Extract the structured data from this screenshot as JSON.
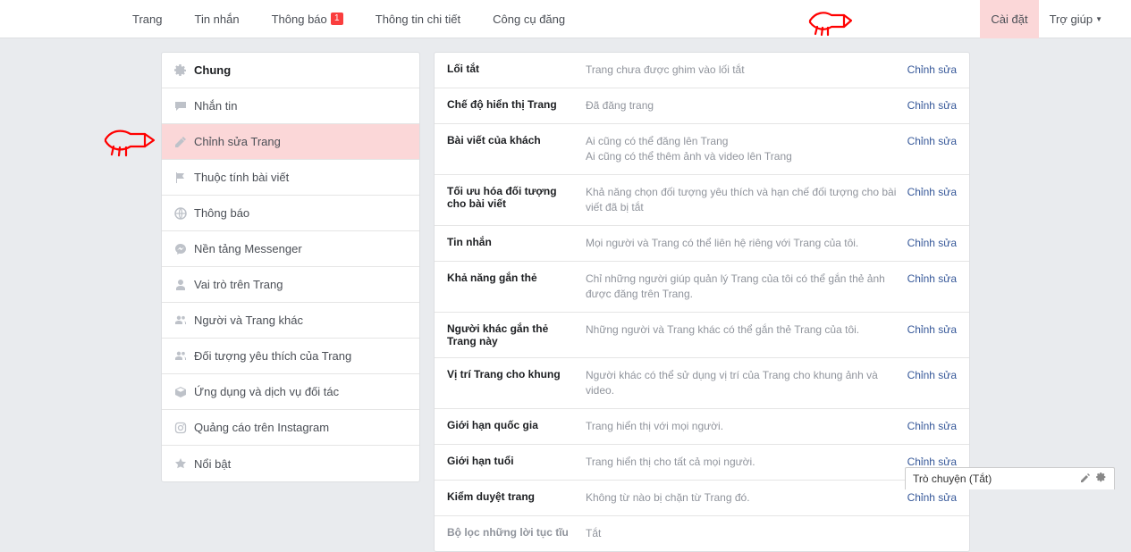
{
  "topnav": {
    "left": [
      {
        "label": "Trang"
      },
      {
        "label": "Tin nhắn"
      },
      {
        "label": "Thông báo",
        "badge": "1"
      },
      {
        "label": "Thông tin chi tiết"
      },
      {
        "label": "Công cụ đăng"
      }
    ],
    "right": [
      {
        "label": "Cài đặt",
        "highlight": true
      },
      {
        "label": "Trợ giúp",
        "dropdown": true
      }
    ]
  },
  "sidebar": [
    {
      "icon": "gear",
      "label": "Chung",
      "active": true
    },
    {
      "icon": "chat",
      "label": "Nhắn tin"
    },
    {
      "icon": "pencil",
      "label": "Chỉnh sửa Trang",
      "highlight": true
    },
    {
      "icon": "flag",
      "label": "Thuộc tính bài viết"
    },
    {
      "icon": "globe",
      "label": "Thông báo"
    },
    {
      "icon": "messenger",
      "label": "Nền tảng Messenger"
    },
    {
      "icon": "person",
      "label": "Vai trò trên Trang"
    },
    {
      "icon": "people",
      "label": "Người và Trang khác"
    },
    {
      "icon": "people",
      "label": "Đối tượng yêu thích của Trang"
    },
    {
      "icon": "cube",
      "label": "Ứng dụng và dịch vụ đối tác"
    },
    {
      "icon": "instagram",
      "label": "Quảng cáo trên Instagram"
    },
    {
      "icon": "star",
      "label": "Nổi bật"
    }
  ],
  "settings": [
    {
      "label": "Lối tắt",
      "value": "Trang chưa được ghim vào lối tắt",
      "edit": "Chỉnh sửa"
    },
    {
      "label": "Chế độ hiển thị Trang",
      "value": "Đã đăng trang",
      "edit": "Chỉnh sửa"
    },
    {
      "label": "Bài viết của khách",
      "value": "Ai cũng có thể đăng lên Trang\nAi cũng có thể thêm ảnh và video lên Trang",
      "edit": "Chỉnh sửa"
    },
    {
      "label": "Tối ưu hóa đối tượng cho bài viết",
      "value": "Khả năng chọn đối tượng yêu thích và hạn chế đối tượng cho bài viết đã bị tắt",
      "edit": "Chỉnh sửa"
    },
    {
      "label": "Tin nhắn",
      "value": "Mọi người và Trang có thể liên hệ riêng với Trang của tôi.",
      "edit": "Chỉnh sửa"
    },
    {
      "label": "Khả năng gắn thẻ",
      "value": "Chỉ những người giúp quản lý Trang của tôi có thể gắn thẻ ảnh được đăng trên Trang.",
      "edit": "Chỉnh sửa"
    },
    {
      "label": "Người khác gắn thẻ Trang này",
      "value": "Những người và Trang khác có thể gắn thẻ Trang của tôi.",
      "edit": "Chỉnh sửa"
    },
    {
      "label": "Vị trí Trang cho khung",
      "value": "Người khác có thể sử dụng vị trí của Trang cho khung ảnh và video.",
      "edit": "Chỉnh sửa"
    },
    {
      "label": "Giới hạn quốc gia",
      "value": "Trang hiển thị với mọi người.",
      "edit": "Chỉnh sửa"
    },
    {
      "label": "Giới hạn tuổi",
      "value": "Trang hiển thị cho tất cả mọi người.",
      "edit": "Chỉnh sửa"
    },
    {
      "label": "Kiểm duyệt trang",
      "value": "Không từ nào bị chặn từ Trang đó.",
      "edit": "Chỉnh sửa"
    },
    {
      "label": "Bộ lọc những lời tục tĩu",
      "value": "Tắt",
      "edit": "",
      "faded": true
    }
  ],
  "chat": {
    "title": "Trò chuyện (Tắt)"
  }
}
